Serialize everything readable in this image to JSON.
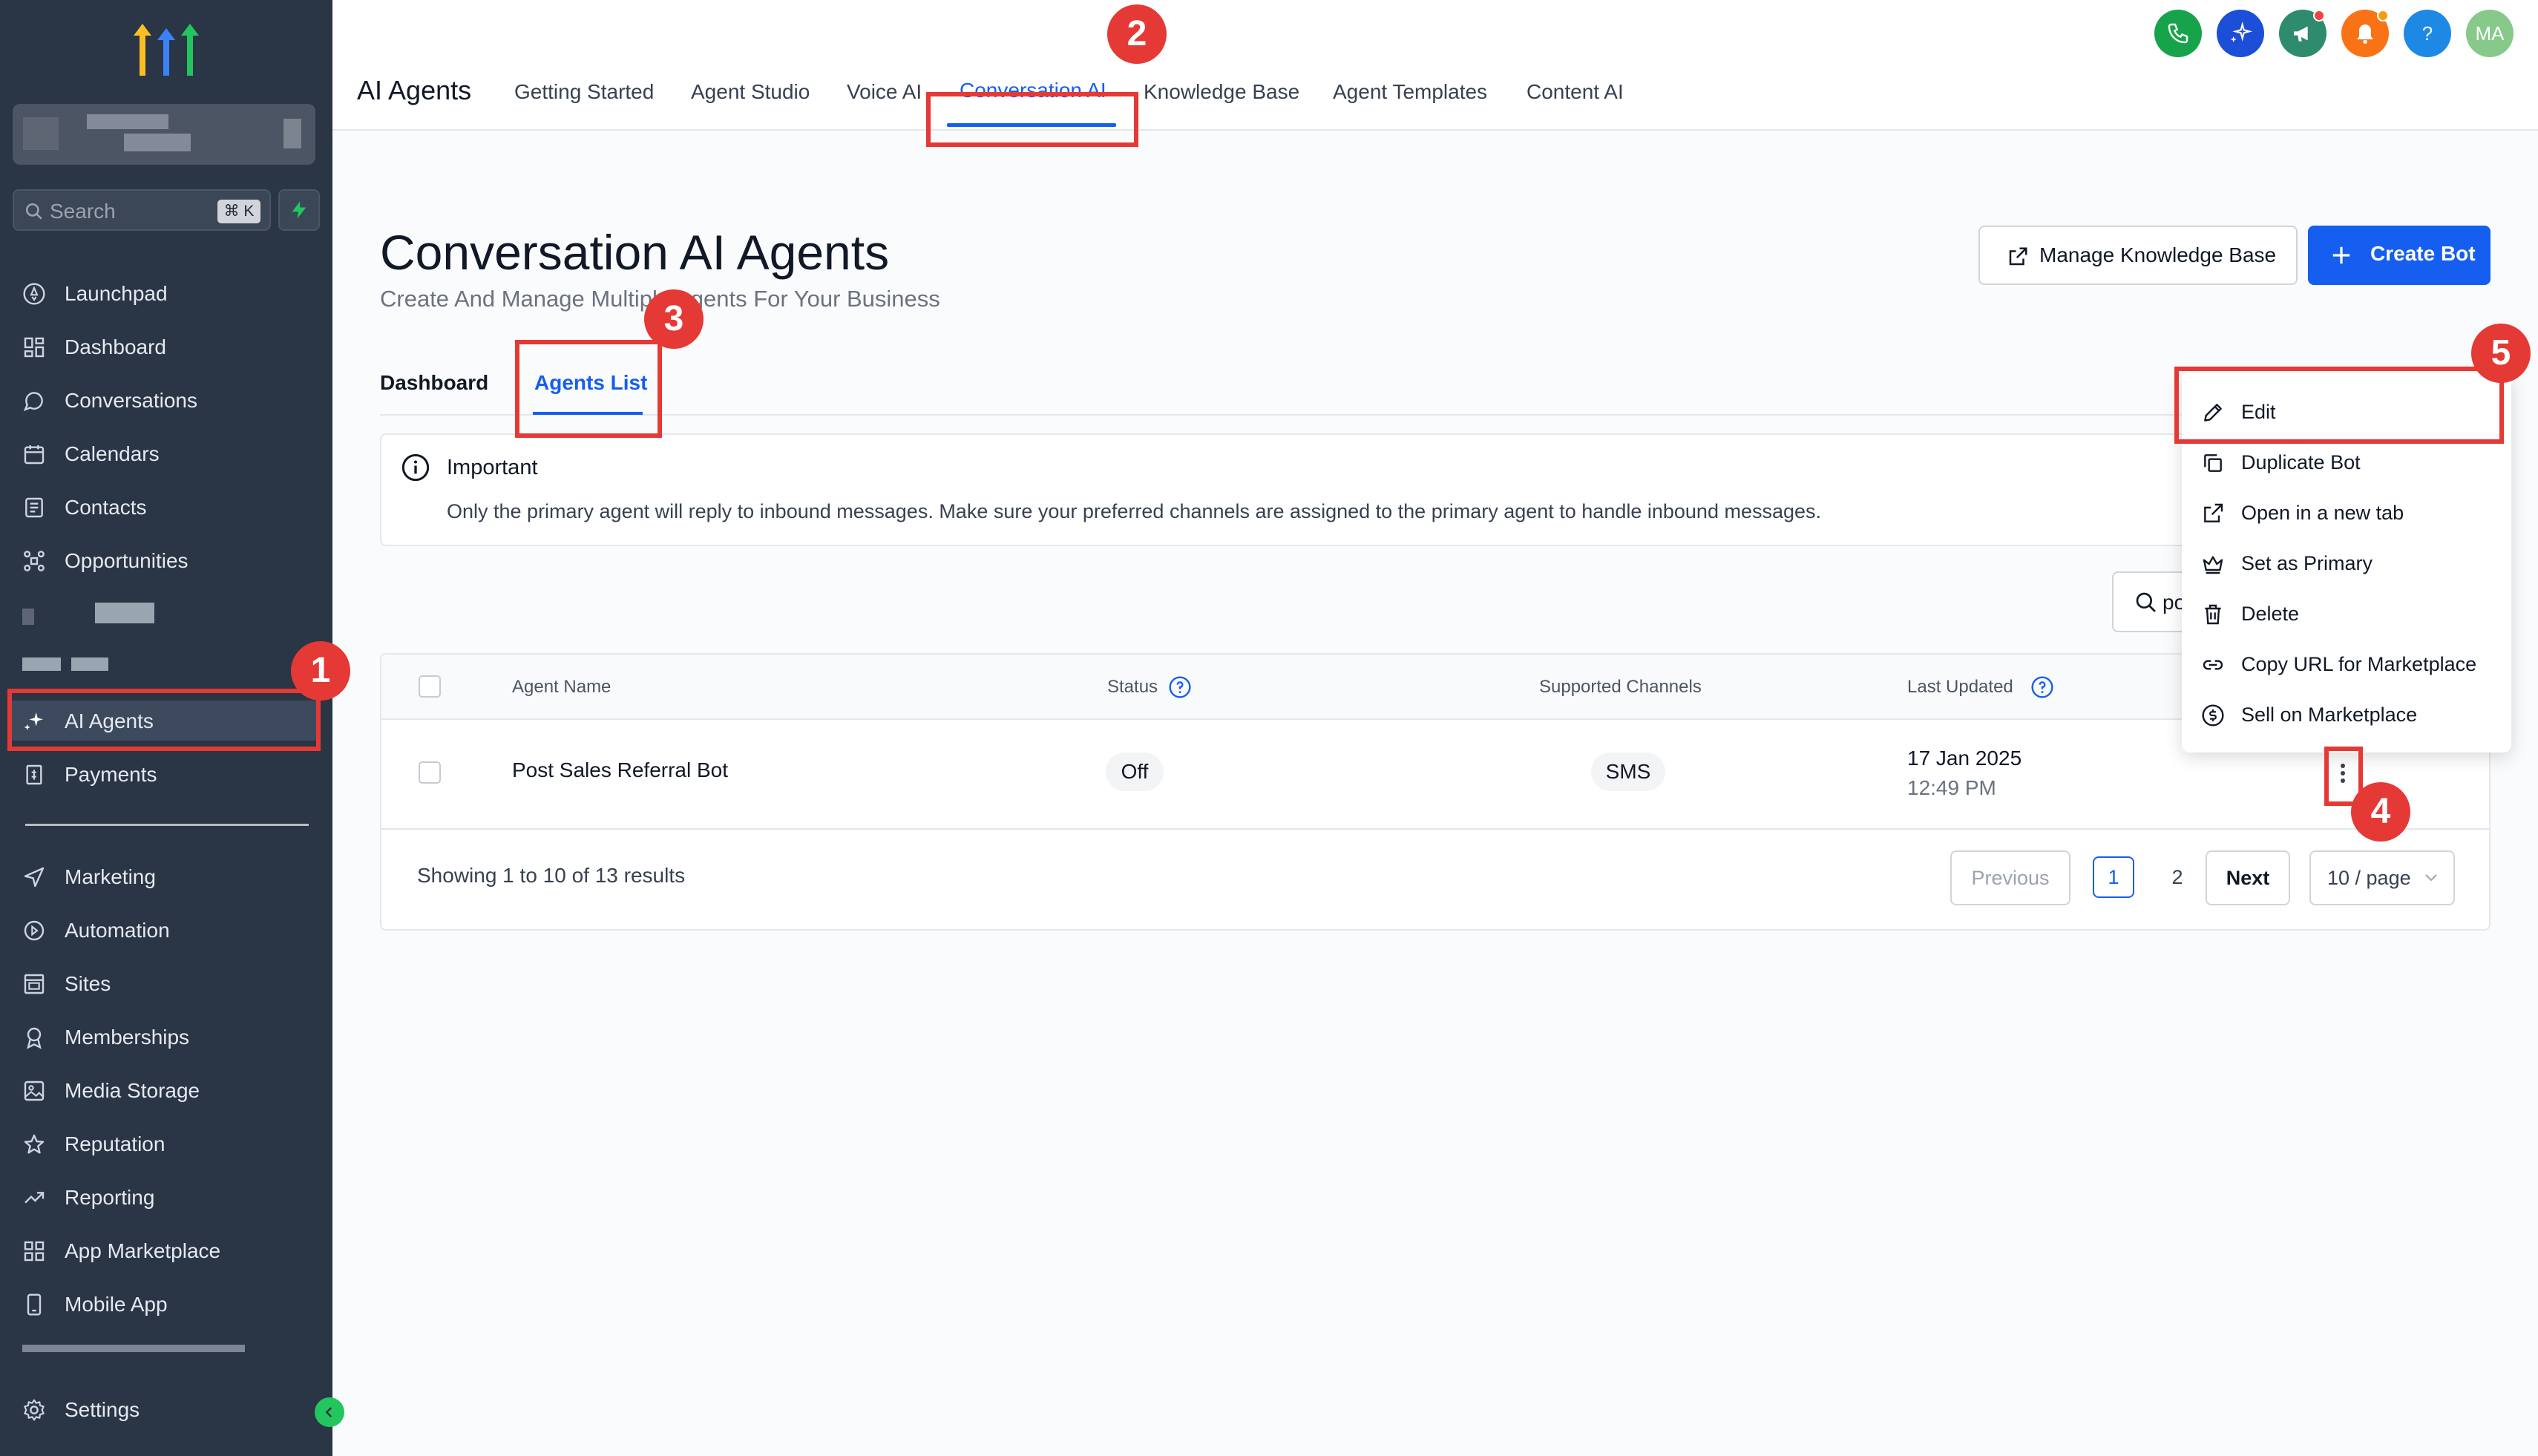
{
  "sidebar": {
    "search_placeholder": "Search",
    "search_shortcut": "⌘ K",
    "items": [
      {
        "label": "Launchpad",
        "icon": "rocket-icon"
      },
      {
        "label": "Dashboard",
        "icon": "grid-icon"
      },
      {
        "label": "Conversations",
        "icon": "chat-icon"
      },
      {
        "label": "Calendars",
        "icon": "calendar-icon"
      },
      {
        "label": "Contacts",
        "icon": "contacts-icon"
      },
      {
        "label": "Opportunities",
        "icon": "funnel-icon"
      },
      {
        "label": "AI Agents",
        "icon": "sparkles-icon"
      },
      {
        "label": "Payments",
        "icon": "invoice-icon"
      },
      {
        "label": "Marketing",
        "icon": "send-icon"
      },
      {
        "label": "Automation",
        "icon": "automation-icon"
      },
      {
        "label": "Sites",
        "icon": "sites-icon"
      },
      {
        "label": "Memberships",
        "icon": "membership-icon"
      },
      {
        "label": "Media Storage",
        "icon": "image-icon"
      },
      {
        "label": "Reputation",
        "icon": "star-icon"
      },
      {
        "label": "Reporting",
        "icon": "trend-icon"
      },
      {
        "label": "App Marketplace",
        "icon": "apps-icon"
      },
      {
        "label": "Mobile App",
        "icon": "mobile-icon"
      },
      {
        "label": "Settings",
        "icon": "gear-icon"
      }
    ]
  },
  "topbar": {
    "title": "AI Agents",
    "tabs": [
      "Getting Started",
      "Agent Studio",
      "Voice AI",
      "Conversation AI",
      "Knowledge Base",
      "Agent Templates",
      "Content AI"
    ],
    "active_tab": "Conversation AI",
    "avatar_initials": "MA",
    "help_glyph": "?"
  },
  "page": {
    "title": "Conversation AI Agents",
    "subtitle": "Create And Manage Multiple Agents For Your Business",
    "manage_kb_label": "Manage Knowledge Base",
    "create_bot_label": "Create Bot",
    "subtabs": [
      "Dashboard",
      "Agents List"
    ],
    "active_subtab": "Agents List"
  },
  "notice": {
    "heading": "Important",
    "body": "Only the primary agent will reply to inbound messages. Make sure your preferred channels are assigned to the primary agent to handle inbound messages."
  },
  "table": {
    "search_value": "po",
    "columns": [
      "Agent Name",
      "Status",
      "Supported Channels",
      "Last Updated"
    ],
    "rows": [
      {
        "name": "Post Sales Referral Bot",
        "status": "Off",
        "channel": "SMS",
        "date": "17 Jan 2025",
        "time": "12:49 PM"
      }
    ],
    "summary": "Showing 1 to 10 of 13 results",
    "pagination": {
      "previous": "Previous",
      "pages": [
        "1",
        "2"
      ],
      "current": "1",
      "next": "Next",
      "per_page": "10 / page"
    }
  },
  "row_menu": {
    "items": [
      "Edit",
      "Duplicate Bot",
      "Open in a new tab",
      "Set as Primary",
      "Delete",
      "Copy URL for Marketplace",
      "Sell on Marketplace"
    ]
  },
  "annotations": [
    "1",
    "2",
    "3",
    "4",
    "5"
  ],
  "colors": {
    "accent": "#155eef",
    "sidebar_bg": "#2a3545",
    "annotation_red": "#e53935"
  }
}
